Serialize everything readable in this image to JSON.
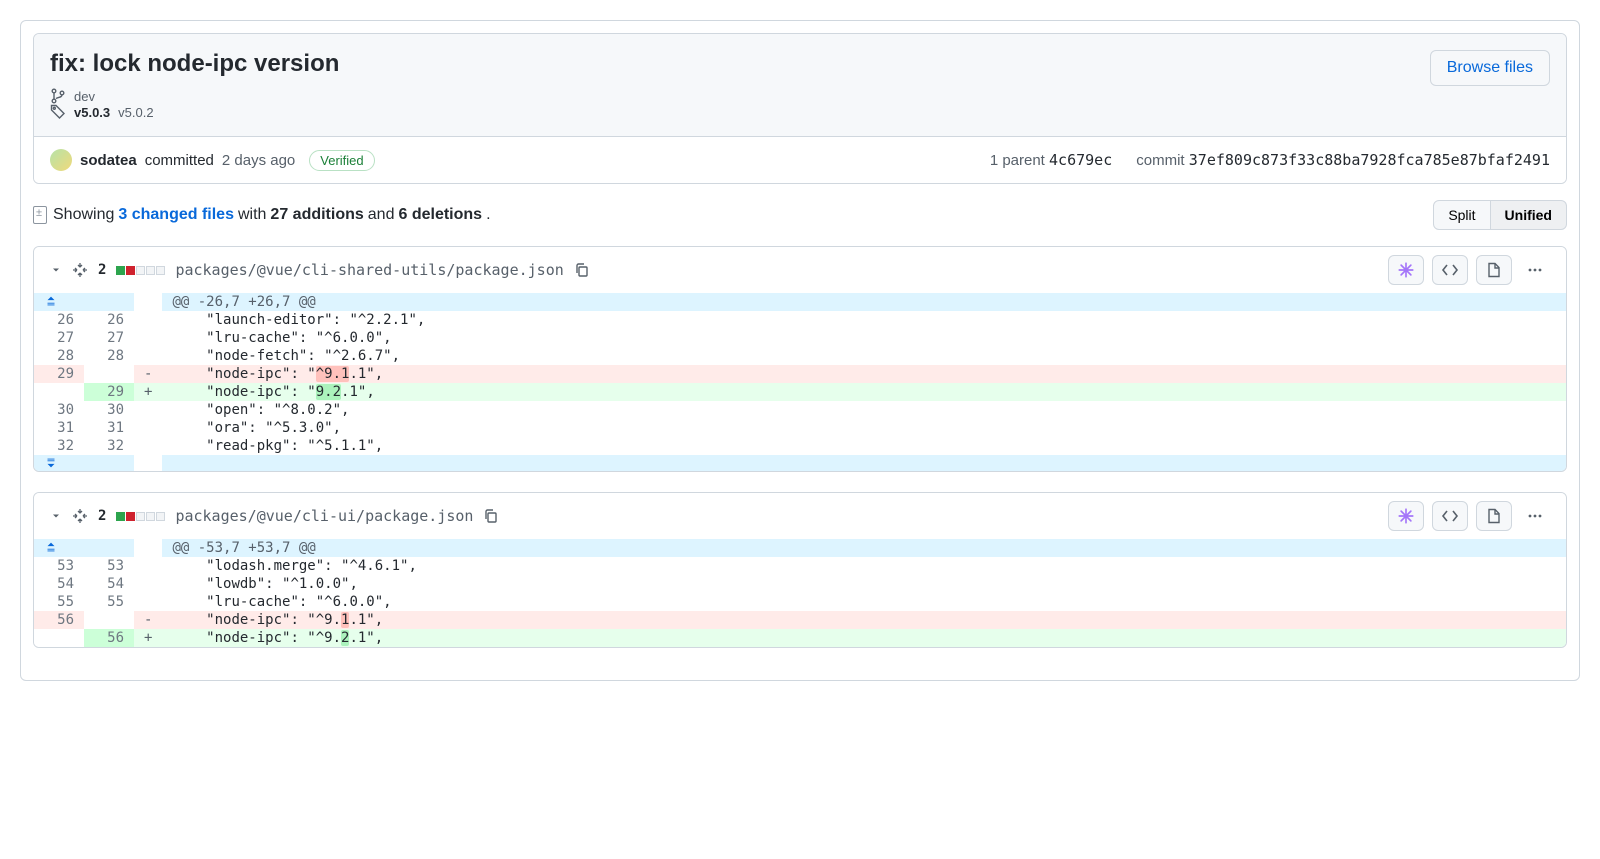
{
  "commit": {
    "title": "fix: lock node-ipc version",
    "branch": "dev",
    "tags": [
      "v5.0.3",
      "v5.0.2"
    ],
    "browse_label": "Browse files",
    "author": "sodatea",
    "committed_label": "committed",
    "time_ago": "2 days ago",
    "verified_label": "Verified",
    "parent_label": "1 parent",
    "parent_sha": "4c679ec",
    "commit_label": "commit",
    "commit_sha": "37ef809c873f33c88ba7928fca785e87bfaf2491"
  },
  "stats": {
    "showing": "Showing",
    "files_link": "3 changed files",
    "with": "with",
    "additions": "27 additions",
    "and": "and",
    "deletions": "6 deletions",
    "period": ".",
    "split_label": "Split",
    "unified_label": "Unified"
  },
  "files": [
    {
      "changes": "2",
      "path": "packages/@vue/cli-shared-utils/package.json",
      "hunk": "@@ -26,7 +26,7 @@",
      "lines": [
        {
          "t": "ctx",
          "ol": "26",
          "nl": "26",
          "m": " ",
          "code": "    \"launch-editor\": \"^2.2.1\","
        },
        {
          "t": "ctx",
          "ol": "27",
          "nl": "27",
          "m": " ",
          "code": "    \"lru-cache\": \"^6.0.0\","
        },
        {
          "t": "ctx",
          "ol": "28",
          "nl": "28",
          "m": " ",
          "code": "    \"node-fetch\": \"^2.6.7\","
        },
        {
          "t": "del",
          "ol": "29",
          "nl": "",
          "m": "-",
          "pre": "    \"node-ipc\": \"",
          "hl": "^9.1",
          "post": ".1\","
        },
        {
          "t": "add",
          "ol": "",
          "nl": "29",
          "m": "+",
          "pre": "    \"node-ipc\": \"",
          "hl": "9.2",
          "post": ".1\","
        },
        {
          "t": "ctx",
          "ol": "30",
          "nl": "30",
          "m": " ",
          "code": "    \"open\": \"^8.0.2\","
        },
        {
          "t": "ctx",
          "ol": "31",
          "nl": "31",
          "m": " ",
          "code": "    \"ora\": \"^5.3.0\","
        },
        {
          "t": "ctx",
          "ol": "32",
          "nl": "32",
          "m": " ",
          "code": "    \"read-pkg\": \"^5.1.1\","
        }
      ],
      "expand_bottom": true
    },
    {
      "changes": "2",
      "path": "packages/@vue/cli-ui/package.json",
      "hunk": "@@ -53,7 +53,7 @@",
      "lines": [
        {
          "t": "ctx",
          "ol": "53",
          "nl": "53",
          "m": " ",
          "code": "    \"lodash.merge\": \"^4.6.1\","
        },
        {
          "t": "ctx",
          "ol": "54",
          "nl": "54",
          "m": " ",
          "code": "    \"lowdb\": \"^1.0.0\","
        },
        {
          "t": "ctx",
          "ol": "55",
          "nl": "55",
          "m": " ",
          "code": "    \"lru-cache\": \"^6.0.0\","
        },
        {
          "t": "del",
          "ol": "56",
          "nl": "",
          "m": "-",
          "pre": "    \"node-ipc\": \"^9.",
          "hl": "1",
          "post": ".1\","
        },
        {
          "t": "add",
          "ol": "",
          "nl": "56",
          "m": "+",
          "pre": "    \"node-ipc\": \"^9.",
          "hl": "2",
          "post": ".1\","
        }
      ],
      "expand_bottom": false
    }
  ]
}
